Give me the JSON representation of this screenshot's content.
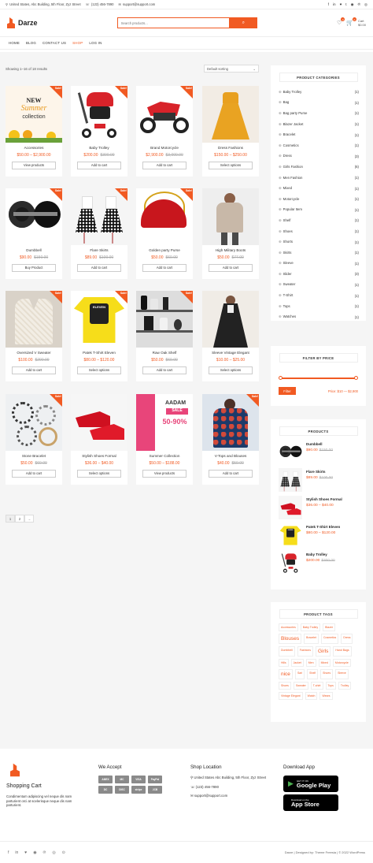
{
  "topbar": {
    "address": "United States, Abc Building, 5th Floor, Zyz Street",
    "phone": "(123) 456-7890",
    "email": "support@support.com",
    "social_icons": [
      "f",
      "in",
      "♥",
      "t",
      "◉",
      "℗",
      "◎"
    ]
  },
  "header": {
    "brand": "Darze",
    "search_placeholder": "Search products...",
    "wishlist_count": "0",
    "cart_count": "0",
    "cart_label": "Cart",
    "cart_total": "$0.00"
  },
  "nav": [
    "HOME",
    "BLOG",
    "CONTACT US",
    "SHOP",
    "LOG IN"
  ],
  "shop": {
    "result_count": "Showing 1–16 of 18 results",
    "sort_label": "Default sorting",
    "products": [
      {
        "name": "Accessories",
        "price": "$50.00 – $2,900.00",
        "old": "",
        "btn": "View products",
        "sale": true,
        "img": "accessories"
      },
      {
        "name": "Baby Trolley",
        "price": "$200.00",
        "old": "$300.00",
        "btn": "Add to cart",
        "sale": true,
        "img": "trolley"
      },
      {
        "name": "Brand Motorcycle",
        "price": "$2,900.00",
        "old": "$3,000.00",
        "btn": "Add to cart",
        "sale": true,
        "img": "motorcycle"
      },
      {
        "name": "Dress Fashions",
        "price": "$150.00 – $250.00",
        "old": "",
        "btn": "Select options",
        "sale": false,
        "img": "dress"
      },
      {
        "name": "Dumbbell",
        "price": "$90.00",
        "old": "$150.00",
        "btn": "Buy Product",
        "sale": true,
        "img": "dumbbell"
      },
      {
        "name": "Flare Skirts",
        "price": "$89.00",
        "old": "$100.00",
        "btn": "Add to cart",
        "sale": true,
        "img": "skirt"
      },
      {
        "name": "Golden party Purse",
        "price": "$50.00",
        "old": "$60.00",
        "btn": "Add to cart",
        "sale": true,
        "img": "purse"
      },
      {
        "name": "High Military Boots",
        "price": "$50.00",
        "old": "$77.00",
        "btn": "Add to cart",
        "sale": false,
        "img": "sweater"
      },
      {
        "name": "Oversized V Sweater",
        "price": "$100.00",
        "old": "$200.00",
        "btn": "Add to cart",
        "sale": true,
        "img": "vsweater"
      },
      {
        "name": "Patek T-Shirt Eleven",
        "price": "$80.00 – $120.00",
        "old": "",
        "btn": "Select options",
        "sale": true,
        "img": "tshirt"
      },
      {
        "name": "Raw Oak Shelf",
        "price": "$50.00",
        "old": "$60.00",
        "btn": "Add to cart",
        "sale": true,
        "img": "shelf"
      },
      {
        "name": "Sleeve Vintage Elegant",
        "price": "$10.00 – $25.00",
        "old": "",
        "btn": "Select options",
        "sale": false,
        "img": "blouse"
      },
      {
        "name": "Stone Bracelet",
        "price": "$50.00",
        "old": "$60.00",
        "btn": "Add to cart",
        "sale": true,
        "img": "bracelet"
      },
      {
        "name": "Stylish Shoes Formal",
        "price": "$36.00 – $40.00",
        "old": "",
        "btn": "Select options",
        "sale": false,
        "img": "shoes"
      },
      {
        "name": "Summer Collection",
        "price": "$50.00 – $188.00",
        "old": "",
        "btn": "View products",
        "sale": false,
        "img": "summer"
      },
      {
        "name": "V-Tops and Blouses",
        "price": "$40.00",
        "old": "$50.00",
        "btn": "Add to cart",
        "sale": true,
        "img": "vtops"
      }
    ],
    "pages": [
      "1",
      "2",
      "→"
    ],
    "img_texts": {
      "accessories": [
        "NEW",
        "Summer",
        "collection"
      ],
      "tshirt": "ELEVEN",
      "summer": [
        "AADAM",
        "SALE",
        "50-90%"
      ]
    }
  },
  "sidebar": {
    "categories_title": "PRODUCT CATEGORIES",
    "categories": [
      {
        "name": "Baby Trolley",
        "count": "(1)"
      },
      {
        "name": "Bag",
        "count": "(1)"
      },
      {
        "name": "Bag party Purse",
        "count": "(1)"
      },
      {
        "name": "Blazer Jacket",
        "count": "(1)"
      },
      {
        "name": "Bracelet",
        "count": "(1)"
      },
      {
        "name": "Cosmetics",
        "count": "(1)"
      },
      {
        "name": "Dress",
        "count": "(3)"
      },
      {
        "name": "Girls Fashion",
        "count": "(6)"
      },
      {
        "name": "Men Fashion",
        "count": "(1)"
      },
      {
        "name": "Mixed",
        "count": "(1)"
      },
      {
        "name": "Motorcycle",
        "count": "(1)"
      },
      {
        "name": "Popular Item",
        "count": "(1)"
      },
      {
        "name": "Shelf",
        "count": "(1)"
      },
      {
        "name": "Shoes",
        "count": "(1)"
      },
      {
        "name": "Shorts",
        "count": "(1)"
      },
      {
        "name": "Skirts",
        "count": "(1)"
      },
      {
        "name": "Sleeve",
        "count": "(1)"
      },
      {
        "name": "Slider",
        "count": "(3)"
      },
      {
        "name": "Sweater",
        "count": "(1)"
      },
      {
        "name": "T-Shirt",
        "count": "(1)"
      },
      {
        "name": "Tops",
        "count": "(1)"
      },
      {
        "name": "Watches",
        "count": "(1)"
      }
    ],
    "filter_title": "FILTER BY PRICE",
    "filter_button": "Filter",
    "price_range": "Price: $10 — $2,900",
    "products_title": "PRODUCTS",
    "products": [
      {
        "name": "Dumbbell",
        "price": "$90.00",
        "old": "$150.00",
        "img": "dumbbell"
      },
      {
        "name": "Flare Skirts",
        "price": "$89.00",
        "old": "$100.00",
        "img": "skirt"
      },
      {
        "name": "Stylish Shoes Formal",
        "price": "$36.00 – $40.00",
        "old": "",
        "img": "shoes"
      },
      {
        "name": "Patek T-Shirt Eleven",
        "price": "$80.00 – $120.00",
        "old": "",
        "img": "tshirt"
      },
      {
        "name": "Baby Trolley",
        "price": "$200.00",
        "old": "$300.00",
        "img": "trolley"
      }
    ],
    "tags_title": "PRODUCT TAGS",
    "tags": [
      {
        "t": "Accessories",
        "big": false
      },
      {
        "t": "Baby Trolley",
        "big": false
      },
      {
        "t": "Blazer",
        "big": false
      },
      {
        "t": "Blouses",
        "big": true
      },
      {
        "t": "Bracelet",
        "big": false
      },
      {
        "t": "Cosmetics",
        "big": false
      },
      {
        "t": "Dress",
        "big": false
      },
      {
        "t": "Dumbbell",
        "big": false
      },
      {
        "t": "Fashions",
        "big": false
      },
      {
        "t": "Girls",
        "big": true
      },
      {
        "t": "Hand Bags",
        "big": false
      },
      {
        "t": "Hills",
        "big": false
      },
      {
        "t": "Jacket",
        "big": false
      },
      {
        "t": "Men",
        "big": false
      },
      {
        "t": "Mixed",
        "big": false
      },
      {
        "t": "Motorcycle",
        "big": false
      },
      {
        "t": "nice",
        "big": true
      },
      {
        "t": "Sari",
        "big": false
      },
      {
        "t": "Shelf",
        "big": false
      },
      {
        "t": "Shoes",
        "big": false
      },
      {
        "t": "Sleeve",
        "big": false
      },
      {
        "t": "Shoes",
        "big": false
      },
      {
        "t": "Sweater",
        "big": false
      },
      {
        "t": "T-shirt",
        "big": false
      },
      {
        "t": "Tops",
        "big": false
      },
      {
        "t": "Trolley",
        "big": false
      },
      {
        "t": "Vintage Elegant",
        "big": false
      },
      {
        "t": "Watch",
        "big": false
      },
      {
        "t": "Wears",
        "big": false
      }
    ]
  },
  "footer": {
    "brand_title": "Shopping Cart",
    "brand_text": "Condimentum adipiscing vel neque dis nam parturient orci at scelerisque neque dis nam parturient.",
    "accept_title": "We Accept",
    "payments": [
      "AMEX",
      "MC",
      "VISA",
      "PayPal",
      "DC",
      "DISC",
      "stripe",
      "JCB"
    ],
    "location_title": "Shop Location",
    "location_address": "United States Abc Building, 5th Floor, Zyz Street",
    "location_phone": "(123) 456-7890",
    "location_email": "support@support.com",
    "app_title": "Download App",
    "google_small": "GET IT ON",
    "google_big": "Google Play",
    "apple_small": "Download on the",
    "apple_big": "App Store",
    "social_icons": [
      "f",
      "in",
      "♥",
      "◉",
      "℗",
      "◎",
      "⊙"
    ],
    "copyright": "Darze | Designed by: Theme Freesia | © 2022 WordPress"
  },
  "colors": {
    "accent": "#f15a22"
  }
}
